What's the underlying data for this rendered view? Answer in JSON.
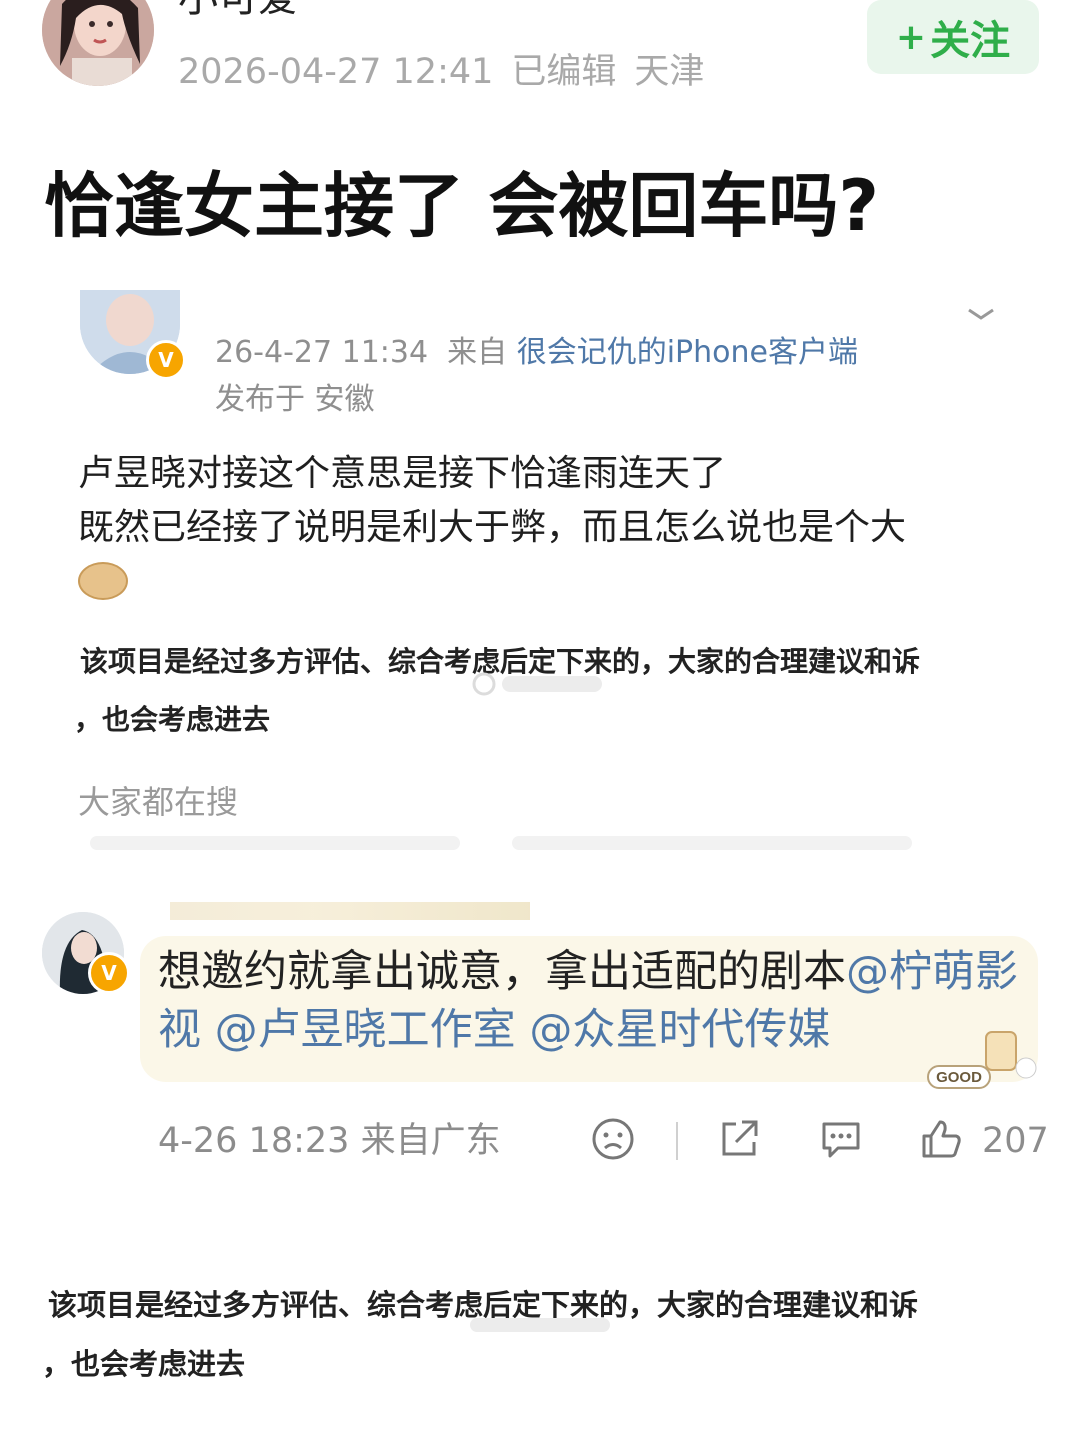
{
  "header": {
    "author_name": "小可爱",
    "date": "2026-04-27 12:41",
    "edited_label": "已编辑",
    "location": "天津",
    "follow_plus": "+",
    "follow_label": "关注"
  },
  "post": {
    "title": "恰逢女主接了 会被回车吗?"
  },
  "quote1": {
    "time": "26-4-27 11:34",
    "from_label": "来自",
    "client": "很会记仇的iPhone客户端",
    "published_in": "发布于 安徽",
    "line1": "卢昱晓对接这个意思是接下恰逢雨连天了",
    "line2": "既然已经接了说明是利大于弊，而且怎么说也是个大",
    "caption_line1": "该项目是经过多方评估、综合考虑后定下来的，大家的合理建议和诉",
    "caption_line2": "，也会考虑进去",
    "search_label": "大家都在搜"
  },
  "quote2": {
    "comment_text": "想邀约就拿出诚意，拿出适配的剧本",
    "mention1": "@柠萌影视",
    "mention2": "@卢昱晓工作室",
    "mention3": "@众星时代传媒",
    "sticker_text": "GOOD",
    "time": "4-26 18:23",
    "from_location": "来自广东",
    "like_count": "207"
  },
  "caption2": {
    "line1": "该项目是经过多方评估、综合考虑后定下来的，大家的合理建议和诉",
    "line2": "，也会考虑进去"
  },
  "icons": {
    "dislike": "sad-face-icon",
    "share": "share-icon",
    "comment": "comment-icon",
    "like": "thumbs-up-icon",
    "verified": "verified-badge-icon"
  },
  "colors": {
    "follow_green": "#2fae4a",
    "link_blue": "#4f78a8",
    "verified_orange": "#f7a500"
  }
}
